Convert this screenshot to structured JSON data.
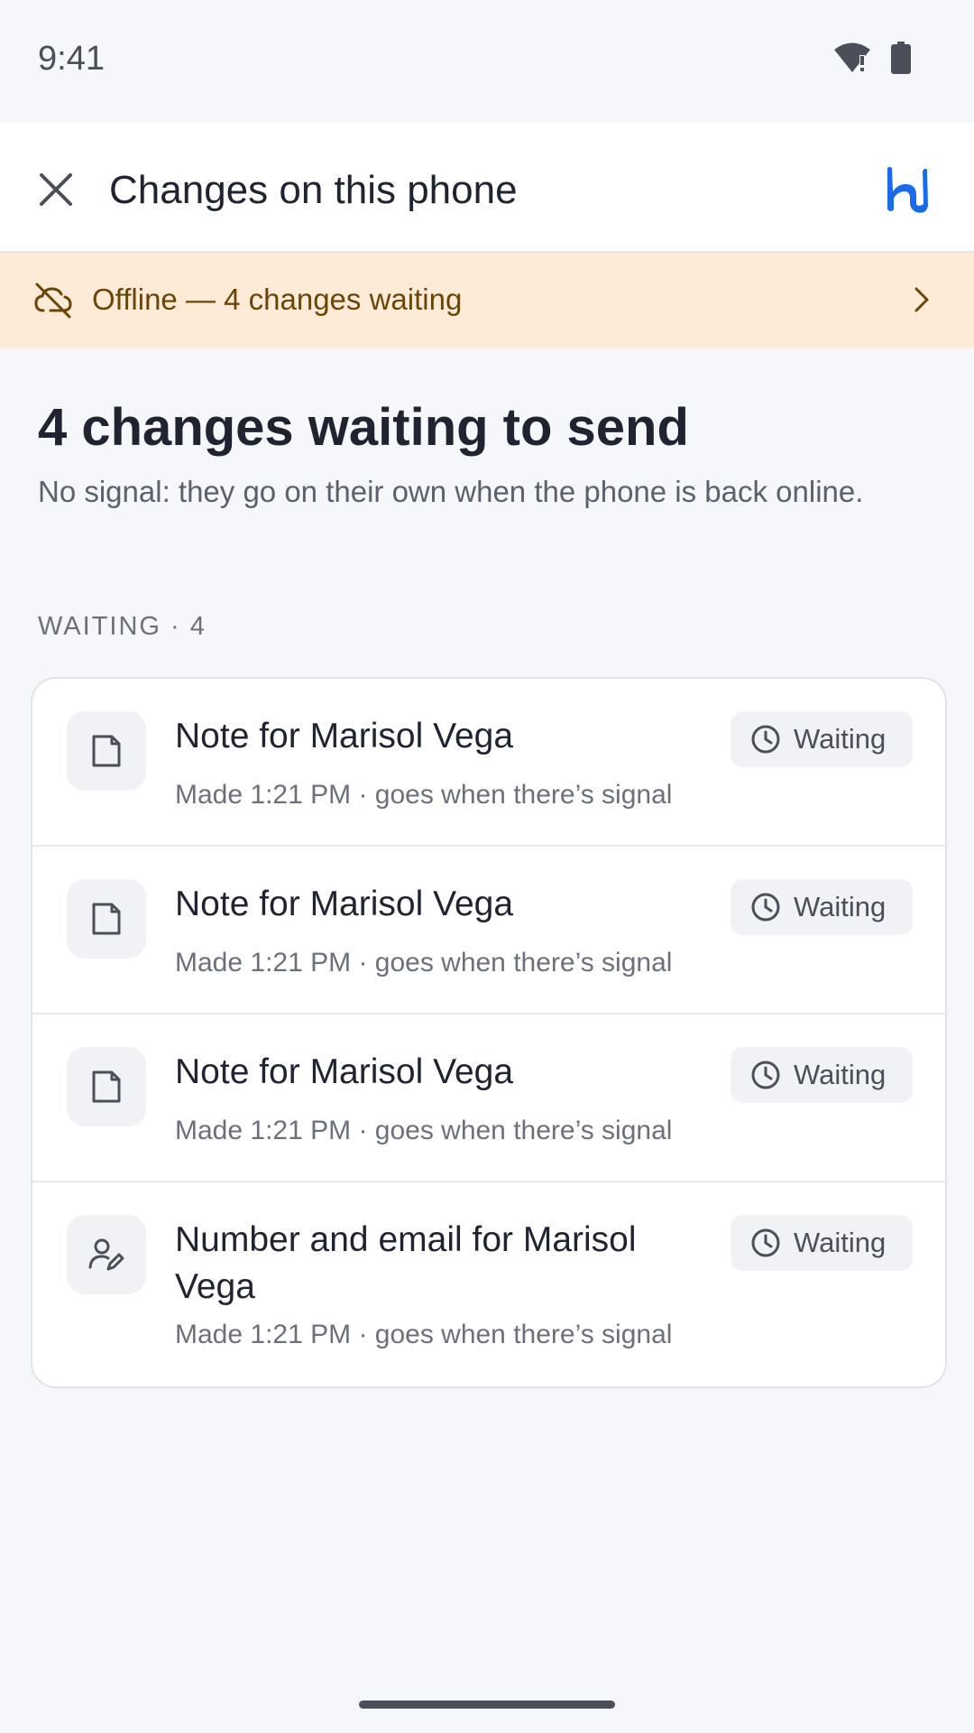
{
  "status_bar": {
    "time": "9:41",
    "icons": [
      "wifi-alert-icon",
      "battery-icon"
    ]
  },
  "app_bar": {
    "title": "Changes on this phone",
    "close_icon": "close-icon",
    "logo_icon": "brand-logo-icon"
  },
  "banner": {
    "text": "Offline — 4 changes waiting",
    "icon": "cloud-off-icon",
    "chevron": "chevron-right-icon"
  },
  "main": {
    "heading": "4 changes waiting to send",
    "subheading": "No signal: they go on their own when the phone is back online.",
    "section_label": "WAITING · 4"
  },
  "items": [
    {
      "title": "Note for Marisol Vega",
      "meta": "Made 1:21 PM · goes when there’s signal",
      "badge": "Waiting",
      "icon": "note-icon"
    },
    {
      "title": "Note for Marisol Vega",
      "meta": "Made 1:21 PM · goes when there’s signal",
      "badge": "Waiting",
      "icon": "note-icon"
    },
    {
      "title": "Note for Marisol Vega",
      "meta": "Made 1:21 PM · goes when there’s signal",
      "badge": "Waiting",
      "icon": "note-icon"
    },
    {
      "title": "Number and email for Marisol Vega",
      "meta": "Made 1:21 PM · goes when there’s signal",
      "badge": "Waiting",
      "icon": "contact-edit-icon"
    }
  ],
  "colors": {
    "background": "#f6f7fb",
    "banner_bg": "#fdebd7",
    "banner_text": "#6b4506",
    "brand_blue": "#1a6be8"
  }
}
